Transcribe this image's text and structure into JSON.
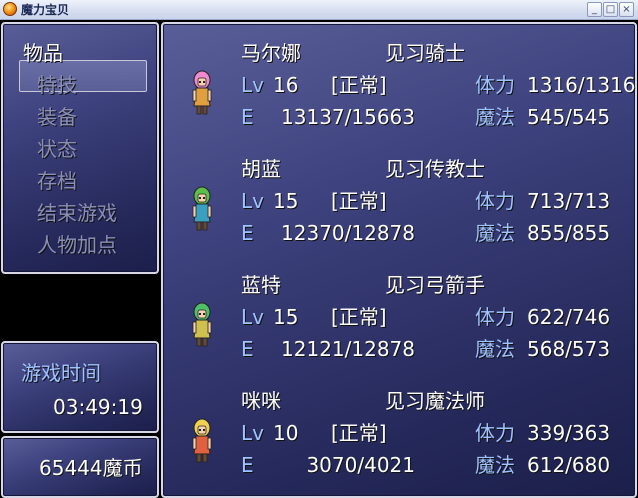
{
  "window": {
    "title": "魔力宝贝",
    "btn_min": "_",
    "btn_max": "□",
    "btn_close": "×"
  },
  "menu": {
    "items": [
      {
        "label": "物品",
        "enabled": true,
        "selected": true
      },
      {
        "label": "特技",
        "enabled": false
      },
      {
        "label": "装备",
        "enabled": false
      },
      {
        "label": "状态",
        "enabled": false
      },
      {
        "label": "存档",
        "enabled": false
      },
      {
        "label": "结束游戏",
        "enabled": false
      },
      {
        "label": "人物加点",
        "enabled": false
      }
    ]
  },
  "playtime": {
    "label": "游戏时间",
    "value": "03:49:19"
  },
  "gold": {
    "amount": "65444",
    "unit": "魔币"
  },
  "party": [
    {
      "name": "马尔娜",
      "class": "见习骑士",
      "lv_label": "Lv",
      "level": "16",
      "state": "[正常]",
      "hp_label": "体力",
      "hp": "1316/1316",
      "exp_label": "E",
      "exp": "13137/15663",
      "mp_label": "魔法",
      "mp": "545/545",
      "hair": "#f08ad0",
      "robe": "#e0a040"
    },
    {
      "name": "胡蓝",
      "class": "见习传教士",
      "lv_label": "Lv",
      "level": "15",
      "state": "[正常]",
      "hp_label": "体力",
      "hp": "713/713",
      "exp_label": "E",
      "exp": "12370/12878",
      "mp_label": "魔法",
      "mp": "855/855",
      "hair": "#5bbf4a",
      "robe": "#3aa0c0"
    },
    {
      "name": "蓝特",
      "class": "见习弓箭手",
      "lv_label": "Lv",
      "level": "15",
      "state": "[正常]",
      "hp_label": "体力",
      "hp": "622/746",
      "exp_label": "E",
      "exp": "12121/12878",
      "mp_label": "魔法",
      "mp": "568/573",
      "hair": "#4fc06a",
      "robe": "#d0c050"
    },
    {
      "name": "咪咪",
      "class": "见习魔法师",
      "lv_label": "Lv",
      "level": "10",
      "state": "[正常]",
      "hp_label": "体力",
      "hp": "339/363",
      "exp_label": "E",
      "exp": "3070/4021",
      "mp_label": "魔法",
      "mp": "612/680",
      "hair": "#f0d050",
      "robe": "#e06040"
    }
  ]
}
